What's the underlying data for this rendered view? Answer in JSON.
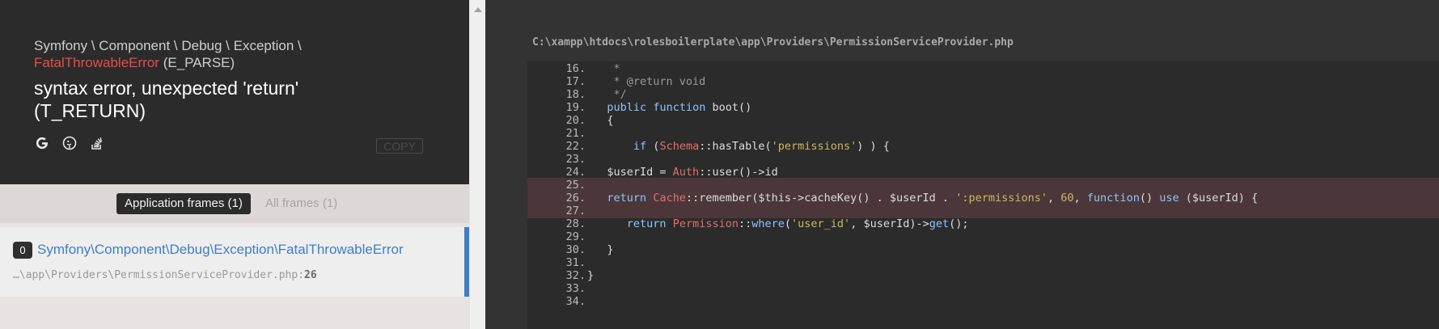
{
  "exception": {
    "namespace": "Symfony \\ Component \\ Debug \\ Exception \\",
    "class_name": "FatalThrowableError",
    "code": "(E_PARSE)",
    "message": "syntax error, unexpected 'return' (T_RETURN)",
    "copy_label": "COPY",
    "search_icons": [
      "google-icon",
      "duckduckgo-icon",
      "stackoverflow-icon"
    ]
  },
  "frame_tabs": {
    "application": "Application frames (1)",
    "all": "All frames (1)"
  },
  "frames": [
    {
      "index": "0",
      "class": "Symfony\\Component\\Debug\\Exception\\FatalThrowableError",
      "file": "…\\app\\Providers\\PermissionServiceProvider.php:",
      "line": "26"
    }
  ],
  "code_view": {
    "file_path": "C:\\xampp\\htdocs\\rolesboilerplate\\app\\Providers\\PermissionServiceProvider.php",
    "highlighted_line": "26",
    "lines": [
      {
        "n": "16.",
        "tokens": [
          {
            "t": "    *",
            "c": "cm"
          }
        ]
      },
      {
        "n": "17.",
        "tokens": [
          {
            "t": "    * @return void",
            "c": "cm"
          }
        ]
      },
      {
        "n": "18.",
        "tokens": [
          {
            "t": "    */",
            "c": "cm"
          }
        ]
      },
      {
        "n": "19.",
        "tokens": [
          {
            "t": "   ",
            "c": ""
          },
          {
            "t": "public",
            "c": "kw"
          },
          {
            "t": " ",
            "c": ""
          },
          {
            "t": "function",
            "c": "kw"
          },
          {
            "t": " boot()",
            "c": ""
          }
        ]
      },
      {
        "n": "20.",
        "tokens": [
          {
            "t": "   {",
            "c": ""
          }
        ]
      },
      {
        "n": "21.",
        "tokens": []
      },
      {
        "n": "22.",
        "tokens": [
          {
            "t": "       ",
            "c": ""
          },
          {
            "t": "if",
            "c": "kw"
          },
          {
            "t": " (",
            "c": ""
          },
          {
            "t": "Schema",
            "c": "cls"
          },
          {
            "t": "::hasTable(",
            "c": ""
          },
          {
            "t": "'permissions'",
            "c": "str"
          },
          {
            "t": ") ) {",
            "c": ""
          }
        ]
      },
      {
        "n": "23.",
        "tokens": []
      },
      {
        "n": "24.",
        "tokens": [
          {
            "t": "   $userId = ",
            "c": ""
          },
          {
            "t": "Auth",
            "c": "cls"
          },
          {
            "t": "::user()->id",
            "c": ""
          }
        ]
      },
      {
        "n": "25.",
        "tokens": []
      },
      {
        "n": "26.",
        "tokens": [
          {
            "t": "   ",
            "c": ""
          },
          {
            "t": "return",
            "c": "kw"
          },
          {
            "t": " ",
            "c": ""
          },
          {
            "t": "Cache",
            "c": "cls"
          },
          {
            "t": "::remember($this->cacheKey() . $userId . ",
            "c": ""
          },
          {
            "t": "':permissions'",
            "c": "str"
          },
          {
            "t": ", ",
            "c": ""
          },
          {
            "t": "60",
            "c": "num"
          },
          {
            "t": ", ",
            "c": ""
          },
          {
            "t": "function",
            "c": "kw"
          },
          {
            "t": "() ",
            "c": ""
          },
          {
            "t": "use",
            "c": "kw"
          },
          {
            "t": " ($userId) {",
            "c": ""
          }
        ]
      },
      {
        "n": "27.",
        "tokens": []
      },
      {
        "n": "28.",
        "tokens": [
          {
            "t": "      ",
            "c": ""
          },
          {
            "t": "return",
            "c": "kw"
          },
          {
            "t": " ",
            "c": ""
          },
          {
            "t": "Permission",
            "c": "cls"
          },
          {
            "t": "::",
            "c": ""
          },
          {
            "t": "where",
            "c": "kw"
          },
          {
            "t": "(",
            "c": ""
          },
          {
            "t": "'user_id'",
            "c": "str"
          },
          {
            "t": ", $userId)->",
            "c": ""
          },
          {
            "t": "get",
            "c": "kw"
          },
          {
            "t": "();",
            "c": ""
          }
        ]
      },
      {
        "n": "29.",
        "tokens": []
      },
      {
        "n": "30.",
        "tokens": [
          {
            "t": "   }",
            "c": ""
          }
        ]
      },
      {
        "n": "31.",
        "tokens": []
      },
      {
        "n": "32.",
        "tokens": [
          {
            "t": "}",
            "c": ""
          }
        ]
      },
      {
        "n": "33.",
        "tokens": []
      },
      {
        "n": "34.",
        "tokens": []
      }
    ]
  },
  "colors": {
    "header_bg": "#2b2b2b",
    "exception_class": "#e94a4a",
    "link_blue": "#3f7ec6",
    "code_bg": "#2b2b2b",
    "highlight_line": "#4b3739",
    "keyword": "#8cc4ff",
    "class_ref": "#e46e6e",
    "string": "#ceb85e"
  }
}
